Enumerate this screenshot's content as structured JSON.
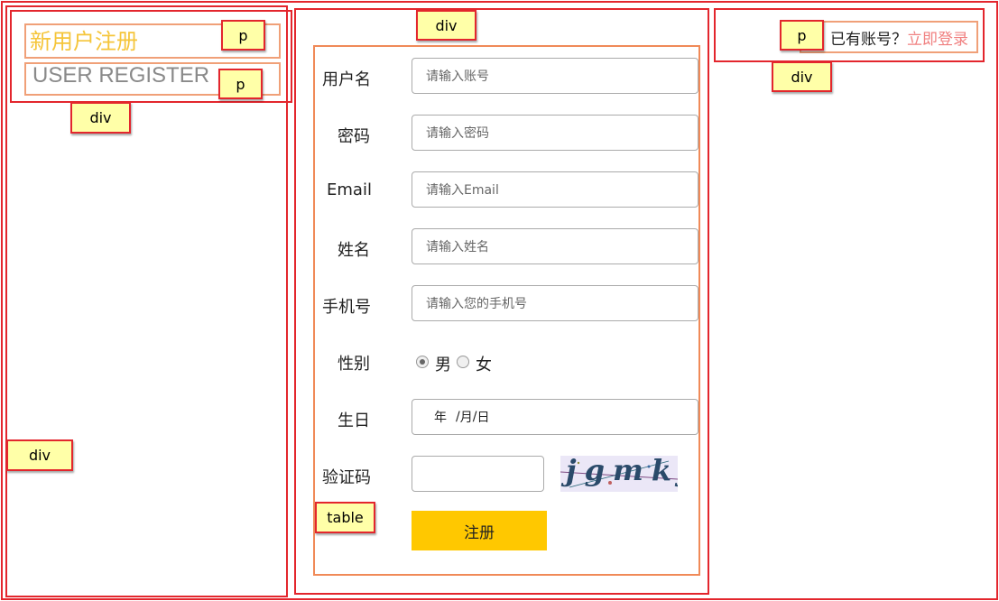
{
  "left_header": {
    "title_cn": "新用户注册",
    "title_en": "USER REGISTER"
  },
  "right_header": {
    "question": "已有账号？",
    "login_link": "立即登录"
  },
  "form": {
    "username": {
      "label": "用户名",
      "placeholder": "请输入账号"
    },
    "password": {
      "label": "密码",
      "placeholder": "请输入密码"
    },
    "email": {
      "label": "Email",
      "placeholder": "请输入Email"
    },
    "name": {
      "label": "姓名",
      "placeholder": "请输入姓名"
    },
    "phone": {
      "label": "手机号",
      "placeholder": "请输入您的手机号"
    },
    "gender": {
      "label": "性别",
      "male": "男",
      "female": "女",
      "selected": "男"
    },
    "birthday": {
      "label": "生日",
      "year": "年",
      "month": "月",
      "day": "日",
      "sep": "/"
    },
    "captcha": {
      "label": "验证码",
      "value": "",
      "image_text": "jgmkj"
    },
    "submit_label": "注册"
  },
  "overlay_tags": {
    "p": "p",
    "div": "div",
    "table": "table"
  },
  "colors": {
    "title_cn": "#f5c53a",
    "title_en": "#8a8a8a",
    "login_link": "#f08080",
    "submit_bg": "#ffc800",
    "outline_red": "#e3262d",
    "outline_orange": "#f08a58",
    "tag_bg": "#ffffa8"
  }
}
